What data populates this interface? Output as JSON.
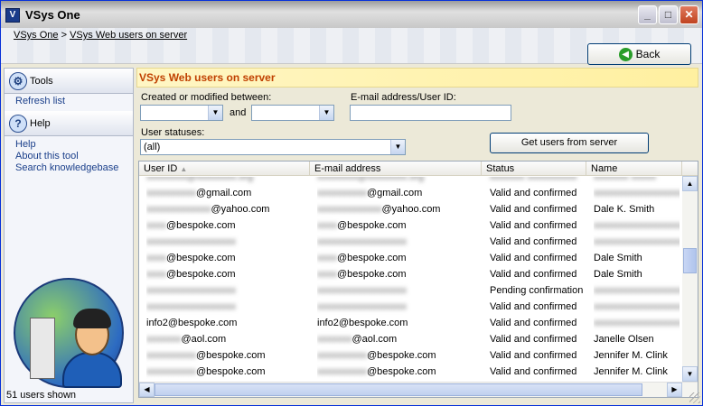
{
  "window": {
    "title": "VSys One",
    "controls": {
      "minimize": "_",
      "maximize": "□",
      "close": "✕"
    }
  },
  "breadcrumb": {
    "items": [
      "VSys One",
      "VSys Web users on server"
    ],
    "separator": ">"
  },
  "toolbar": {
    "back_label": "Back",
    "back_icon": "green-circle-arrow-left"
  },
  "sidebar": {
    "tools_header": "Tools",
    "tools_items": [
      "Refresh list"
    ],
    "help_header": "Help",
    "help_items": [
      "Help",
      "About this tool",
      "Search knowledgebase"
    ],
    "status": "51 users shown"
  },
  "content": {
    "header": "VSys Web users on server",
    "created_label": "Created or modified between:",
    "and_label": "and",
    "email_label": "E-mail address/User ID:",
    "statuses_label": "User statuses:",
    "statuses_value": "(all)",
    "get_users_label": "Get users from server",
    "accent_color": "#c04000"
  },
  "grid": {
    "columns": [
      "User ID",
      "E-mail address",
      "Status",
      "Name"
    ],
    "rows": [
      {
        "user_id": "@gmail.com",
        "email": "@gmail.com",
        "status": "Valid and confirmed",
        "name": ""
      },
      {
        "user_id": "@yahoo.com",
        "email": "@yahoo.com",
        "status": "Valid and confirmed",
        "name": "Dale K. Smith"
      },
      {
        "user_id": "@bespoke.com",
        "email": "@bespoke.com",
        "status": "Valid and confirmed",
        "name": ""
      },
      {
        "user_id": "",
        "email": "",
        "status": "Valid and confirmed",
        "name": ""
      },
      {
        "user_id": "@bespoke.com",
        "email": "@bespoke.com",
        "status": "Valid and confirmed",
        "name": "Dale Smith"
      },
      {
        "user_id": "@bespoke.com",
        "email": "@bespoke.com",
        "status": "Valid and confirmed",
        "name": "Dale Smith"
      },
      {
        "user_id": "",
        "email": "",
        "status": "Pending confirmation",
        "name": ""
      },
      {
        "user_id": "",
        "email": "",
        "status": "Valid and confirmed",
        "name": ""
      },
      {
        "user_id": "info2@bespoke.com",
        "email": "info2@bespoke.com",
        "status": "Valid and confirmed",
        "name": ""
      },
      {
        "user_id": "@aol.com",
        "email": "@aol.com",
        "status": "Valid and confirmed",
        "name": "Janelle Olsen"
      },
      {
        "user_id": "@bespoke.com",
        "email": "@bespoke.com",
        "status": "Valid and confirmed",
        "name": "Jennifer M. Clink"
      },
      {
        "user_id": "@bespoke.com",
        "email": "@bespoke.com",
        "status": "Valid and confirmed",
        "name": "Jennifer M. Clink"
      }
    ]
  }
}
